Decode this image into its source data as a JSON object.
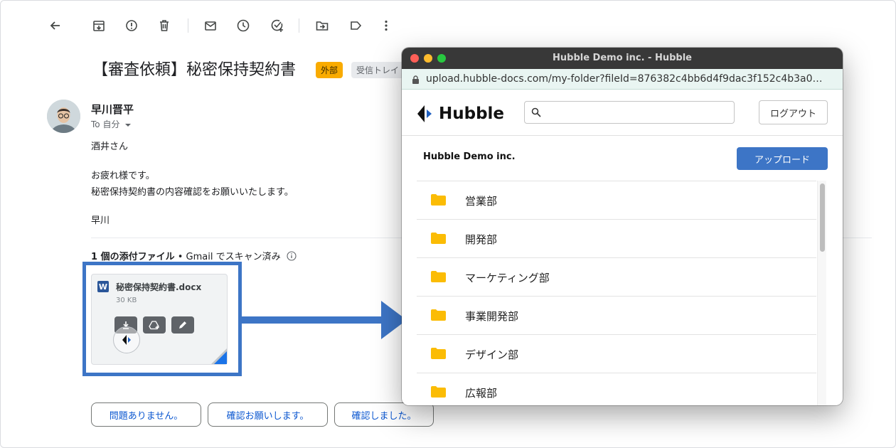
{
  "gmail": {
    "toolbar": {
      "icons": [
        "back-arrow-icon",
        "archive-icon",
        "report-spam-icon",
        "delete-icon",
        "mark-unread-icon",
        "snooze-icon",
        "add-task-icon",
        "move-to-icon",
        "label-icon",
        "more-icon"
      ]
    },
    "subject": "【審査依頼】秘密保持契約書",
    "badges": {
      "external": "外部",
      "inbox": "受信トレイ"
    },
    "sender": {
      "name": "早川晋平",
      "to": "To 自分"
    },
    "body": {
      "greeting": "酒井さん",
      "line1": "お疲れ様です。",
      "line2": "秘密保持契約書の内容確認をお願いいたします。",
      "signature": "早川"
    },
    "attachments": {
      "heading_bold": "1 個の添付ファイル",
      "heading_rest": " • Gmail でスキャン済み",
      "file": {
        "type_letter": "W",
        "name": "秘密保持契約書.docx",
        "size": "30 KB"
      }
    },
    "smart_replies": [
      "問題ありません。",
      "確認お願いします。",
      "確認しました。"
    ]
  },
  "popup": {
    "window_title": "Hubble Demo inc. - Hubble",
    "url": "upload.hubble-docs.com/my-folder?fileId=876382c4bb6d4f9dac3f152c4b3a0…",
    "logo_text": "Hubble",
    "search_placeholder": "",
    "logout_label": "ログアウト",
    "org_name": "Hubble Demo inc.",
    "upload_label": "アップロード",
    "folders": [
      "営業部",
      "開発部",
      "マーケティング部",
      "事業開発部",
      "デザイン部",
      "広報部"
    ]
  },
  "colors": {
    "accent_blue": "#3d75c6",
    "folder_yellow": "#fbbc05",
    "external_badge": "#f9ab00",
    "reply_text": "#0b57d0"
  }
}
